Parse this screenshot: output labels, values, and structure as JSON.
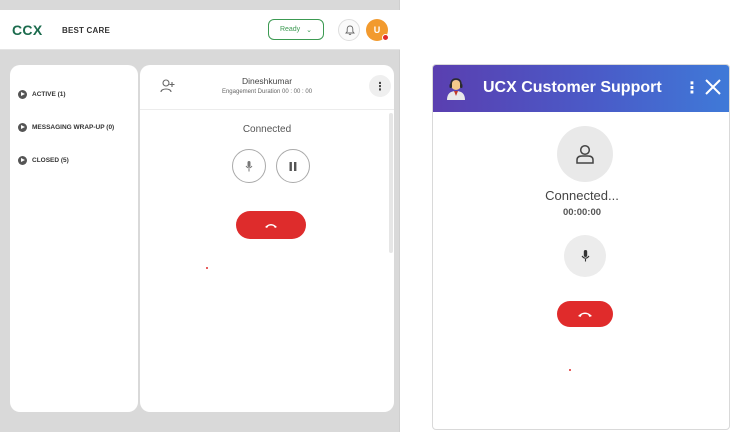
{
  "agent_desktop": {
    "logo": "CCX",
    "tenant": "BEST CARE",
    "status_select": {
      "value": "Ready"
    },
    "avatar_initial": "U",
    "conversations": [
      {
        "label": "ACTIVE (1)"
      },
      {
        "label": "MESSAGING WRAP-UP (0)"
      },
      {
        "label": "CLOSED (5)"
      }
    ],
    "call": {
      "caller_name": "Dineshkumar",
      "engagement": "Engagement Duration 00 : 00 : 00",
      "status": "Connected"
    },
    "colors": {
      "accent": "#3c9a52",
      "danger": "#de2c2c"
    }
  },
  "widget": {
    "title": "UCX Customer Support",
    "status": "Connected...",
    "timer": "00:00:00",
    "colors": {
      "header_start": "#5a3fb0",
      "header_end": "#3f7ad8",
      "danger": "#e02b2b"
    }
  },
  "icons": [
    "bell-icon",
    "add-user-icon",
    "more-vertical-icon",
    "mic-icon",
    "pause-icon",
    "end-call-icon",
    "support-agent-icon",
    "close-icon",
    "user-icon"
  ]
}
